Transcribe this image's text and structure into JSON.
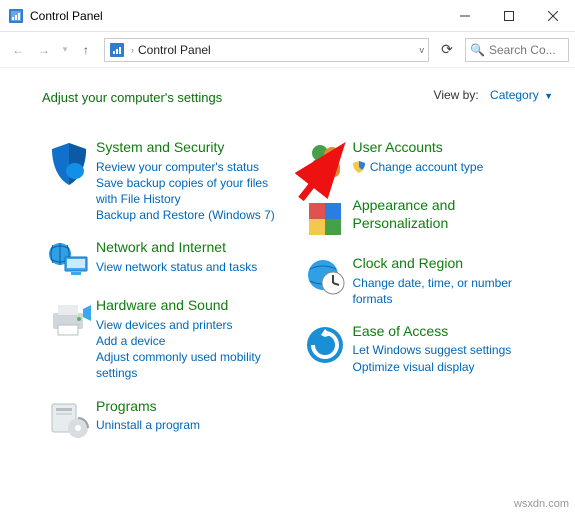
{
  "window": {
    "title": "Control Panel"
  },
  "breadcrumb": {
    "location": "Control Panel"
  },
  "search": {
    "placeholder": "Search Co..."
  },
  "heading": "Adjust your computer's settings",
  "viewby": {
    "label": "View by:",
    "mode": "Category"
  },
  "left": {
    "sys": {
      "title": "System and Security",
      "l1": "Review your computer's status",
      "l2": "Save backup copies of your files with File History",
      "l3": "Backup and Restore (Windows 7)"
    },
    "net": {
      "title": "Network and Internet",
      "l1": "View network status and tasks"
    },
    "hw": {
      "title": "Hardware and Sound",
      "l1": "View devices and printers",
      "l2": "Add a device",
      "l3": "Adjust commonly used mobility settings"
    },
    "prog": {
      "title": "Programs",
      "l1": "Uninstall a program"
    }
  },
  "right": {
    "ua": {
      "title": "User Accounts",
      "l1": "Change account type"
    },
    "ap": {
      "title": "Appearance and Personalization"
    },
    "clk": {
      "title": "Clock and Region",
      "l1": "Change date, time, or number formats"
    },
    "eoa": {
      "title": "Ease of Access",
      "l1": "Let Windows suggest settings",
      "l2": "Optimize visual display"
    }
  },
  "watermark": "wsxdn.com"
}
